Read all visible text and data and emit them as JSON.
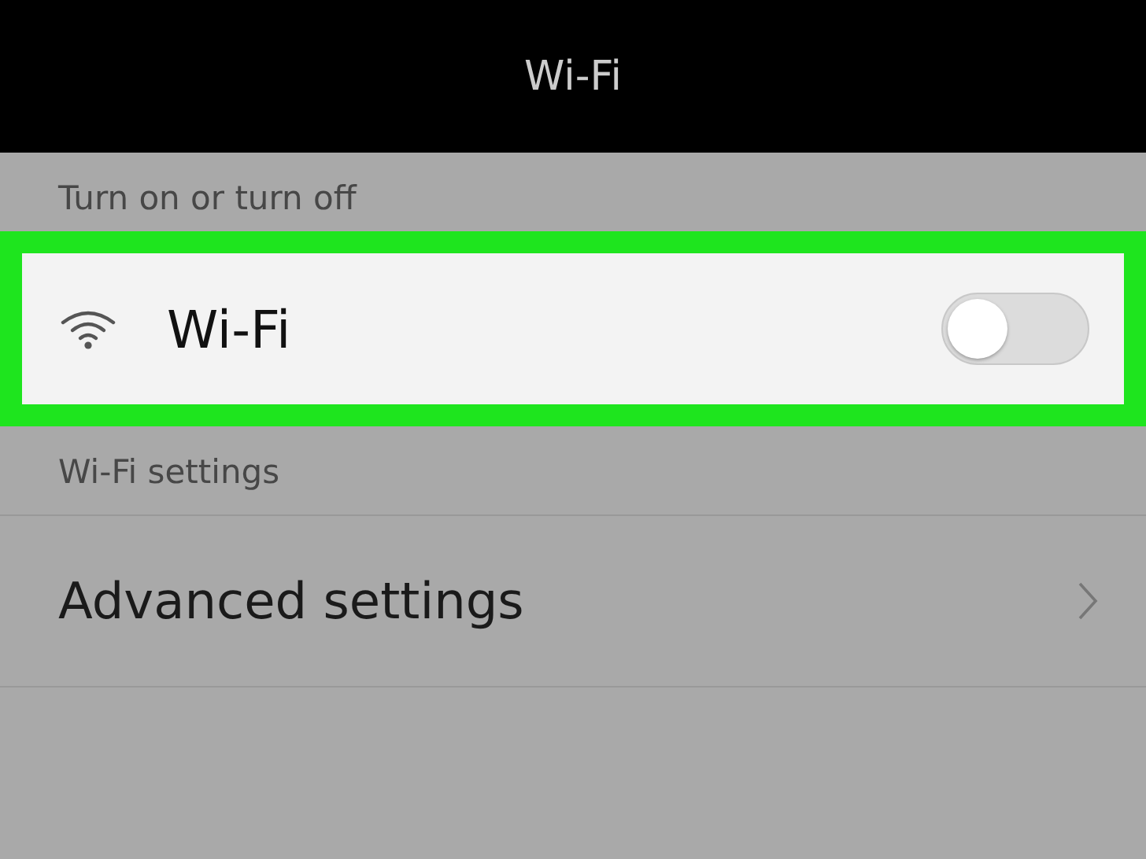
{
  "header": {
    "title": "Wi-Fi"
  },
  "sections": [
    {
      "label": "Turn on or turn off",
      "rows": [
        {
          "kind": "toggle",
          "label": "Wi-Fi",
          "on": false,
          "highlighted": true
        }
      ]
    },
    {
      "label": "Wi-Fi settings",
      "rows": [
        {
          "kind": "link",
          "label": "Advanced settings",
          "highlighted": false
        }
      ]
    }
  ]
}
